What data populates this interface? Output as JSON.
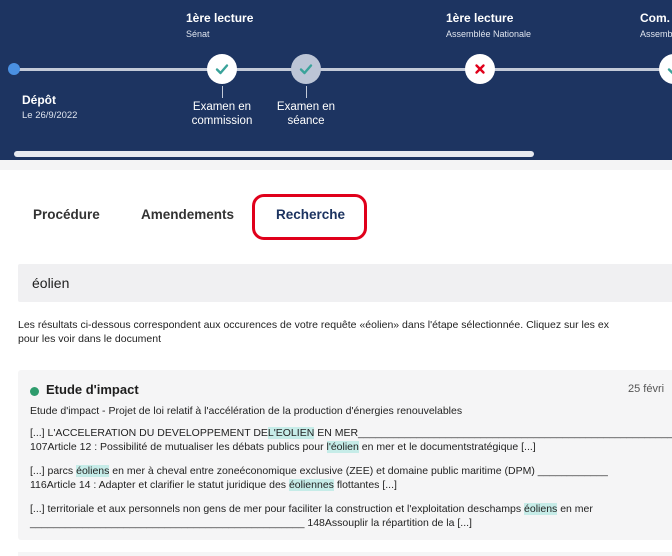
{
  "timeline": {
    "stages": [
      {
        "title": "1ère lecture",
        "subtitle": "Sénat"
      },
      {
        "title": "1ère lecture",
        "subtitle": "Assemblée Nationale"
      },
      {
        "title": "Com. m",
        "subtitle": "Assemb"
      }
    ],
    "depot": {
      "title": "Dépôt",
      "date": "Le 26/9/2022"
    },
    "steps": [
      {
        "label_1": "Examen en",
        "label_2": "commission",
        "status": "done"
      },
      {
        "label_1": "Examen en",
        "label_2": "séance",
        "status": "done"
      }
    ],
    "nodes": [
      {
        "icon": "check-icon",
        "style": "white"
      },
      {
        "icon": "check-icon",
        "style": "grey"
      },
      {
        "icon": "close-icon",
        "style": "white"
      },
      {
        "icon": "check-icon",
        "style": "white"
      }
    ]
  },
  "tabs": [
    {
      "label": "Procédure"
    },
    {
      "label": "Amendements"
    },
    {
      "label": "Recherche",
      "active": true
    }
  ],
  "search": {
    "value": "éolien"
  },
  "intro": {
    "line1": "Les résultats ci-dessous correspondent aux occurences de votre requête «éolien» dans l'étape sélectionnée. Cliquez sur les ex",
    "line2": "pour les voir dans le document"
  },
  "result": {
    "title": "Etude d'impact",
    "date": "25 févri",
    "subtitle": "Etude d'impact - Projet de loi relatif à l'accélération de la production d'énergies renouvelables",
    "excerpt1": {
      "l1_a": "[...] L'ACCELERATION DU DEVELOPPEMENT DE",
      "l1_hl": "L'EOLIEN",
      "l1_b": " EN MER_______________________________________________________",
      "l2_a": "107Article 12 : Possibilité de mutualiser les débats publics pour ",
      "l2_hl": "l'éolien",
      "l2_b": " en mer et le documentstratégique [...]"
    },
    "excerpt2": {
      "l1_a": "[...] parcs ",
      "l1_hl": "éoliens",
      "l1_b": " en mer à cheval entre zoneéconomique exclusive (ZEE) et domaine public maritime (DPM) ____________",
      "l2_a": "116Article 14 : Adapter et clarifier le statut juridique des ",
      "l2_hl": "éoliennes",
      "l2_b": " flottantes [...]"
    },
    "excerpt3": {
      "l1_a": "[...] territoriale et aux personnels non gens de mer pour faciliter la construction et l'exploitation deschamps ",
      "l1_hl": "éoliens",
      "l1_b": " en mer",
      "l2": "_______________________________________________ 148Assouplir la répartition de la [...]"
    }
  },
  "colors": {
    "header_bg": "#1d3461",
    "highlight": "#c6ece8",
    "active_tab": "#1d3461",
    "annotation": "#e0001b",
    "status_dot": "#2e9c6d"
  }
}
